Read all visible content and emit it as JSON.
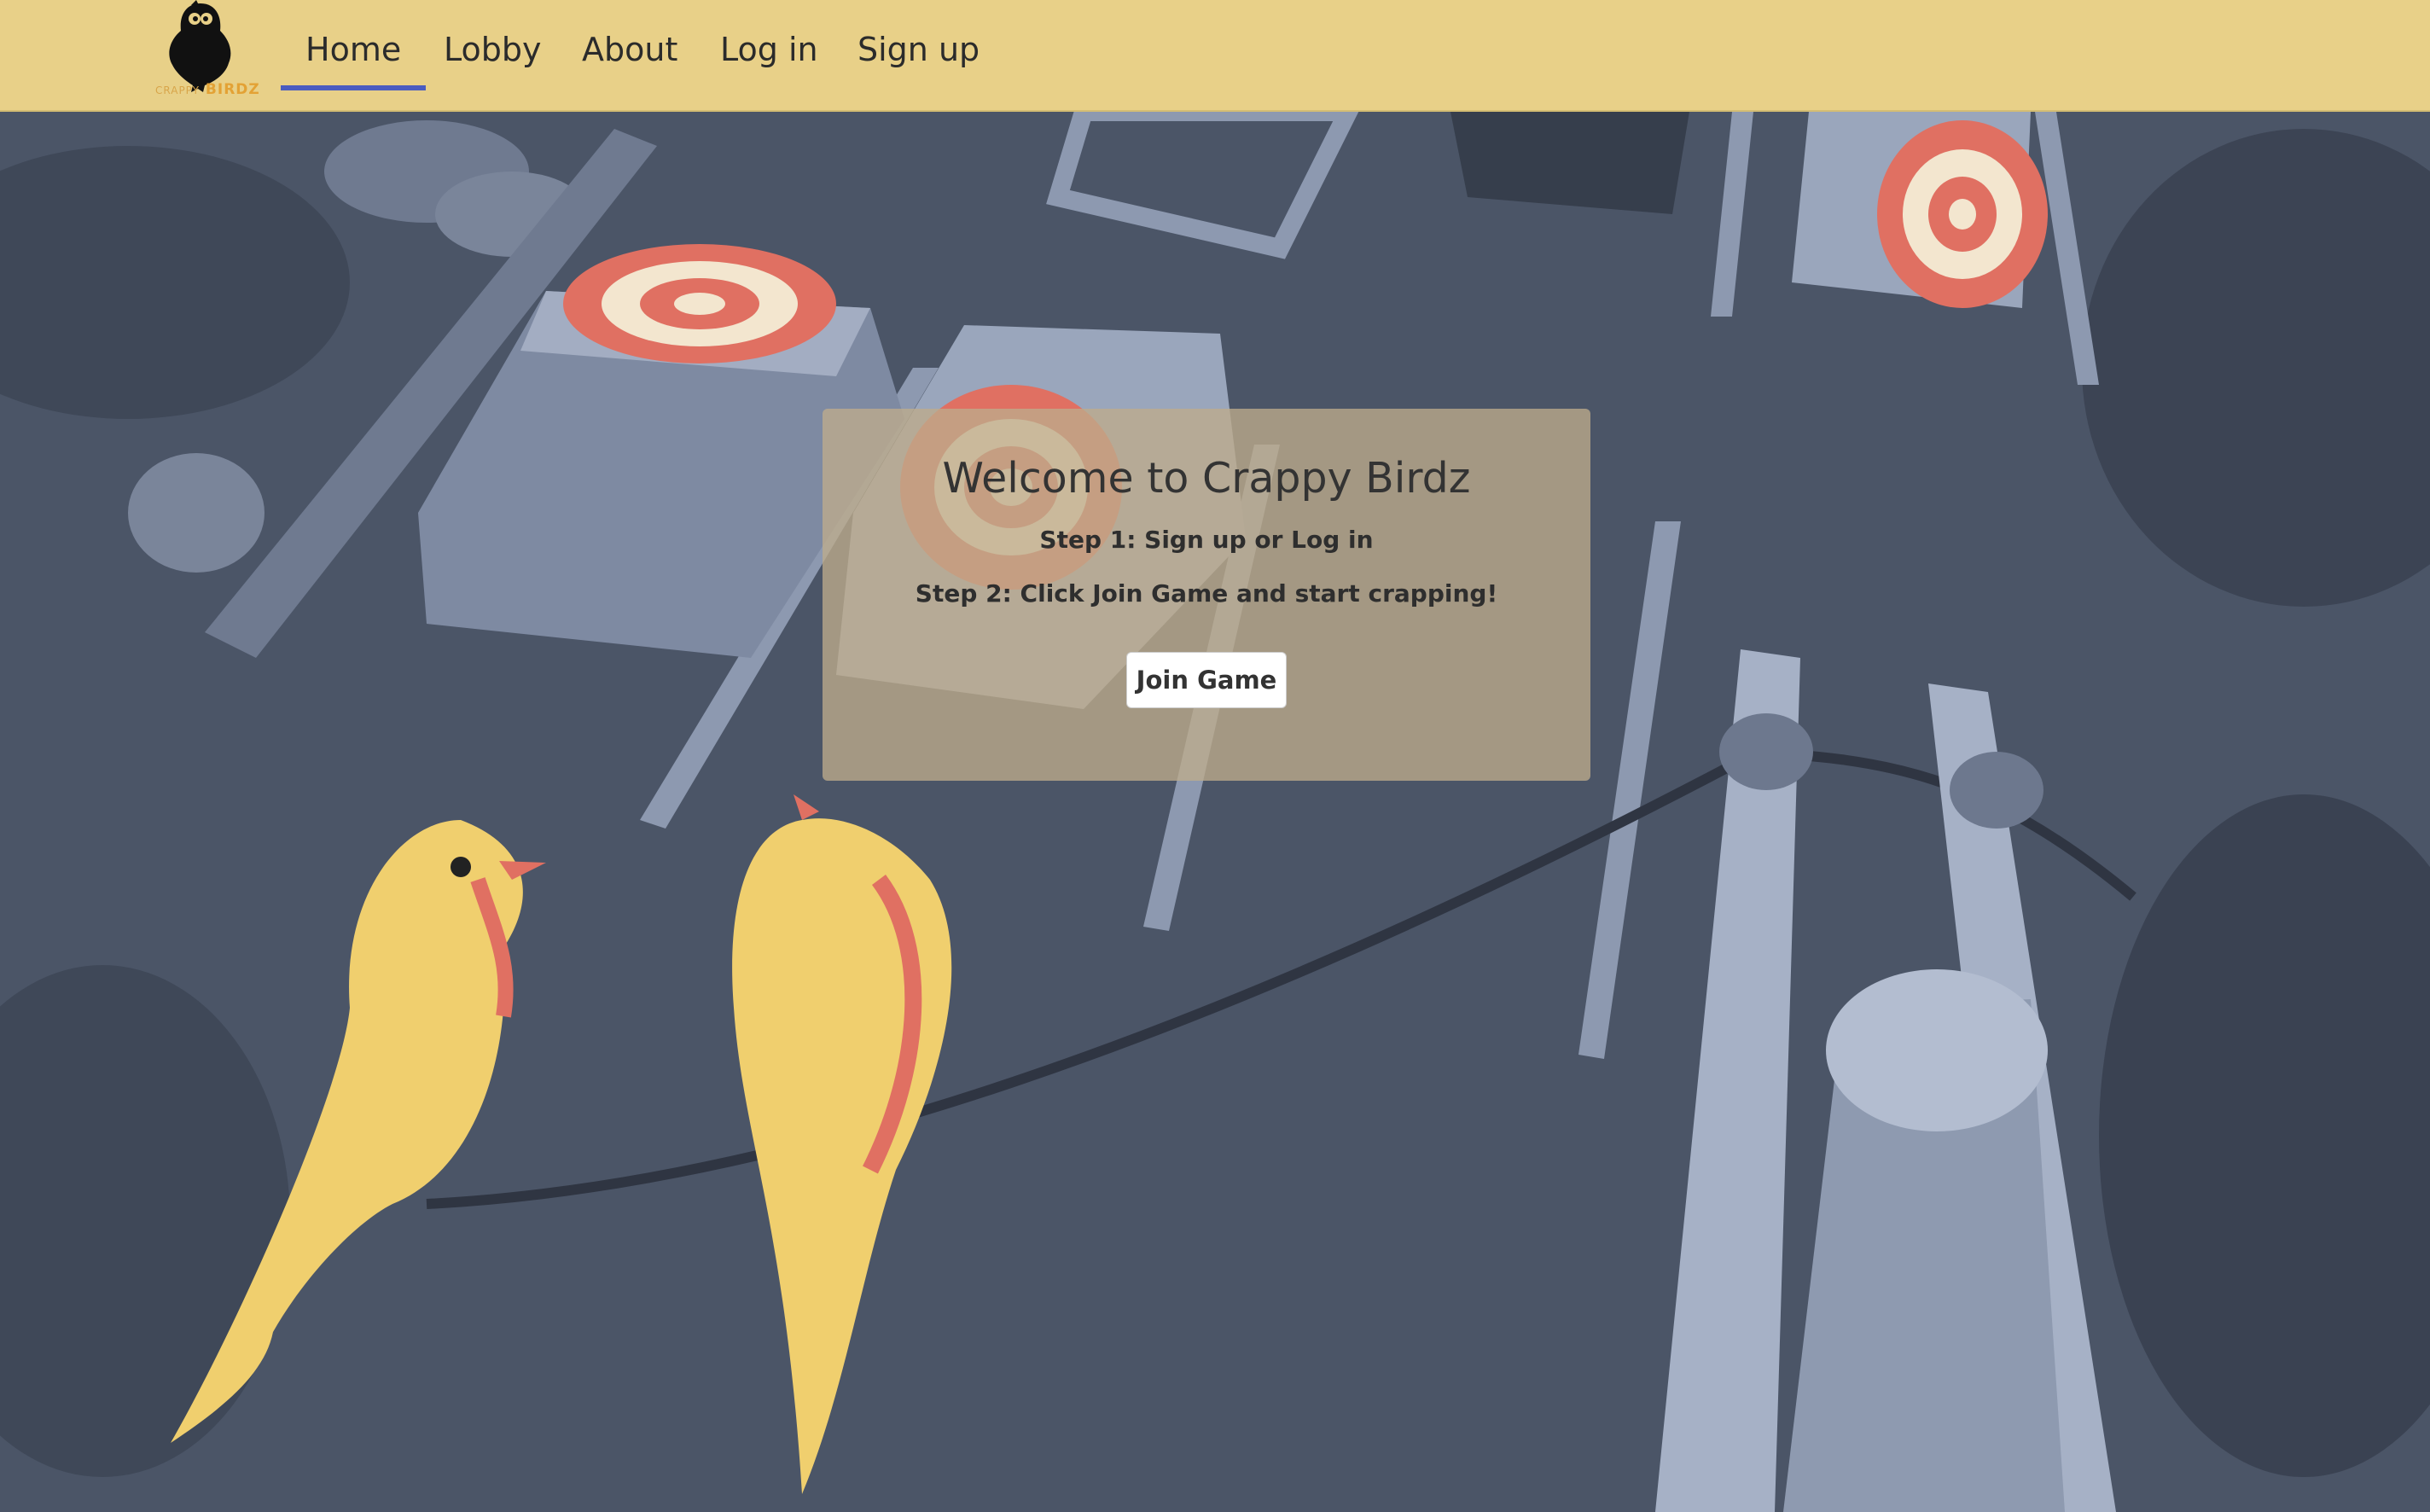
{
  "brand": {
    "name_small": "CRAPPY",
    "name_large": "BIRDZ",
    "accent_color": "#e3a235"
  },
  "nav": {
    "items": [
      {
        "label": "Home",
        "active": true
      },
      {
        "label": "Lobby",
        "active": false
      },
      {
        "label": "About",
        "active": false
      },
      {
        "label": "Log in",
        "active": false
      },
      {
        "label": "Sign up",
        "active": false
      }
    ],
    "background": "#e8d088",
    "active_underline": "#4a5cc0"
  },
  "welcome": {
    "title": "Welcome to Crappy Birdz",
    "step1": "Step 1: Sign up or Log in",
    "step2": "Step 2: Click Join Game and start crapping!",
    "join_button": "Join Game"
  }
}
